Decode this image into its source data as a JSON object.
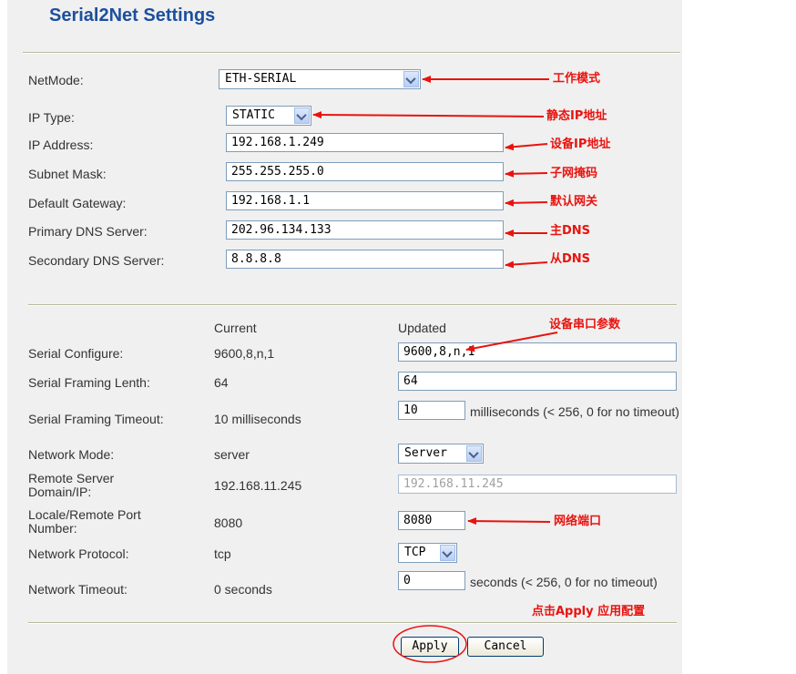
{
  "page_title": "Serial2Net Settings",
  "network": {
    "netmode_label": "NetMode:",
    "netmode_value": "ETH-SERIAL",
    "ip_type_label": "IP Type:",
    "ip_type_value": "STATIC",
    "ip_address_label": "IP Address:",
    "ip_address_value": "192.168.1.249",
    "subnet_mask_label": "Subnet Mask:",
    "subnet_mask_value": "255.255.255.0",
    "gateway_label": "Default Gateway:",
    "gateway_value": "192.168.1.1",
    "primary_dns_label": "Primary DNS Server:",
    "primary_dns_value": "202.96.134.133",
    "secondary_dns_label": "Secondary DNS Server:",
    "secondary_dns_value": "8.8.8.8"
  },
  "serial": {
    "col_current": "Current",
    "col_updated": "Updated",
    "rows": {
      "serial_configure": {
        "label": "Serial Configure:",
        "current": "9600,8,n,1",
        "updated": "9600,8,n,1"
      },
      "framing_length": {
        "label": "Serial Framing Lenth:",
        "current": "64",
        "updated": "64"
      },
      "framing_timeout": {
        "label": "Serial Framing Timeout:",
        "current": "10 milliseconds",
        "updated": "10",
        "note": "milliseconds (< 256, 0 for no timeout)"
      },
      "network_mode": {
        "label": "Network Mode:",
        "current": "server",
        "updated": "Server"
      },
      "remote_server": {
        "label": "Remote Server Domain/IP:",
        "current": "192.168.11.245",
        "updated": "192.168.11.245"
      },
      "port_number": {
        "label": "Locale/Remote Port Number:",
        "current": "8080",
        "updated": "8080"
      },
      "network_protocol": {
        "label": "Network Protocol:",
        "current": "tcp",
        "updated": "TCP"
      },
      "network_timeout": {
        "label": "Network Timeout:",
        "current": "0 seconds",
        "updated": "0",
        "note": "seconds (< 256, 0 for no timeout)"
      }
    }
  },
  "buttons": {
    "apply": "Apply",
    "cancel": "Cancel"
  },
  "annotations": {
    "netmode": "工作模式",
    "ip_type": "静态IP地址",
    "ip_address": "设备IP地址",
    "subnet_mask": "子网掩码",
    "gateway": "默认网关",
    "primary_dns": "主DNS",
    "secondary_dns": "从DNS",
    "serial_params": "设备串口参数",
    "port": "网络端口",
    "apply_hint": "点击Apply 应用配置"
  },
  "colors": {
    "title": "#1d4f9e",
    "annotation": "#e8130f",
    "panel_bg": "#f0f0f0"
  }
}
